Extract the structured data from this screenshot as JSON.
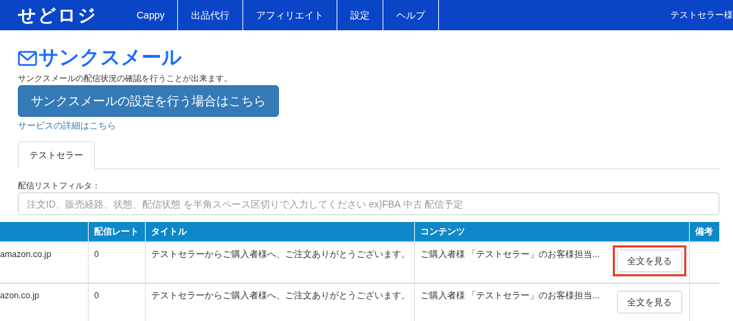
{
  "header": {
    "logo": "せどロジ",
    "nav": [
      {
        "label": "Cappy"
      },
      {
        "label": "出品代行"
      },
      {
        "label": "アフィリエイト"
      },
      {
        "label": "設定"
      },
      {
        "label": "ヘルプ"
      }
    ],
    "user": "テストセラー様"
  },
  "page": {
    "title": "サンクスメール",
    "description": "サンクスメールの配信状況の確認を行うことが出来ます。",
    "settings_button": "サンクスメールの設定を行う場合はこちら",
    "details_link": "サービスの詳細はこちら"
  },
  "tabs": [
    {
      "label": "テストセラー",
      "selected": true
    }
  ],
  "filter": {
    "label": "配信リストフィルタ：",
    "placeholder": "注文ID、販売経路、状態、配信状態 を半角スペース区切りで入力してください ex)FBA 中古 配信予定"
  },
  "table": {
    "columns": [
      "配信レート",
      "タイトル",
      "コンテンツ",
      "備考"
    ],
    "rows": [
      {
        "column_1": "amazon.co.jp",
        "rate": "0",
        "title": "テストセラーからご購入者様へ、ご注文ありがとうございます。",
        "content": "ご購入者様 「テストセラー」のお客様担当...",
        "button": "全文を見る",
        "highlighted": true
      },
      {
        "column_1": "azon.co.jp",
        "rate": "0",
        "title": "テストセラーからご購入者様へ、ご注文ありがとうございます。",
        "content": "ご購入者様 「テストセラー」のお客様担当...",
        "button": "全文を見る",
        "highlighted": false
      }
    ]
  }
}
